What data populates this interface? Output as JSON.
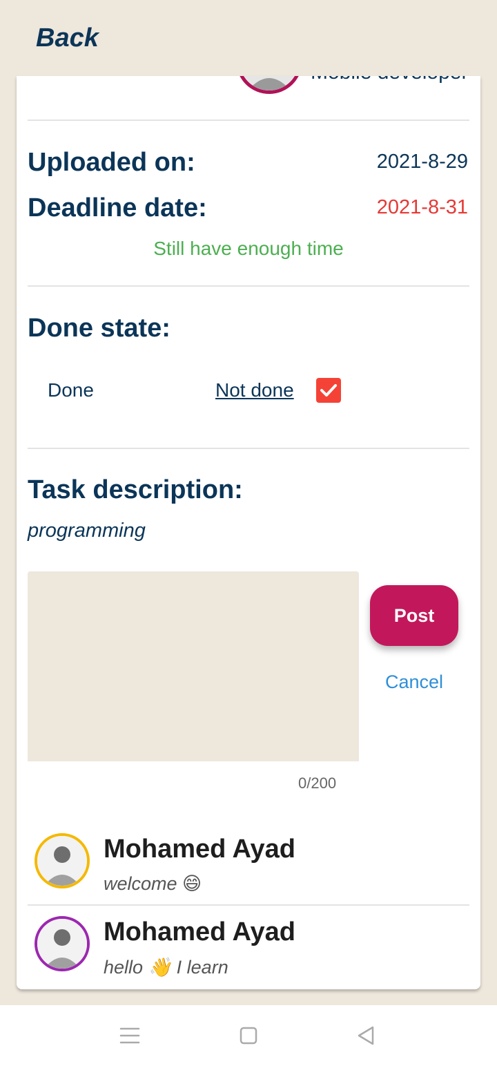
{
  "appbar": {
    "back_label": "Back"
  },
  "author": {
    "title": "Mobile developer"
  },
  "dates": {
    "uploaded_label": "Uploaded on:",
    "uploaded_value": "2021-8-29",
    "deadline_label": "Deadline date:",
    "deadline_value": "2021-8-31",
    "time_message": "Still have enough time"
  },
  "done_state": {
    "label": "Done state:",
    "done_option": "Done",
    "not_done_option": "Not done",
    "checked": true
  },
  "description": {
    "label": "Task description:",
    "text": "programming"
  },
  "comment_box": {
    "value": "",
    "counter": "0/200",
    "post_label": "Post",
    "cancel_label": "Cancel"
  },
  "comments": [
    {
      "author": "Mohamed Ayad",
      "text": "welcome 😄"
    },
    {
      "author": "Mohamed Ayad",
      "text": "hello 👋 I learn"
    }
  ],
  "colors": {
    "background": "#EEE7DC",
    "primary_text": "#0B3558",
    "accent": "#C2185B",
    "deadline": "#E53935",
    "ok": "#4CAF50",
    "link": "#2E8FD8",
    "avatar_ring_1": "#F5B800",
    "avatar_ring_2": "#9C27B0"
  },
  "nav_icons": [
    "menu-icon",
    "home-square-icon",
    "back-triangle-icon"
  ]
}
